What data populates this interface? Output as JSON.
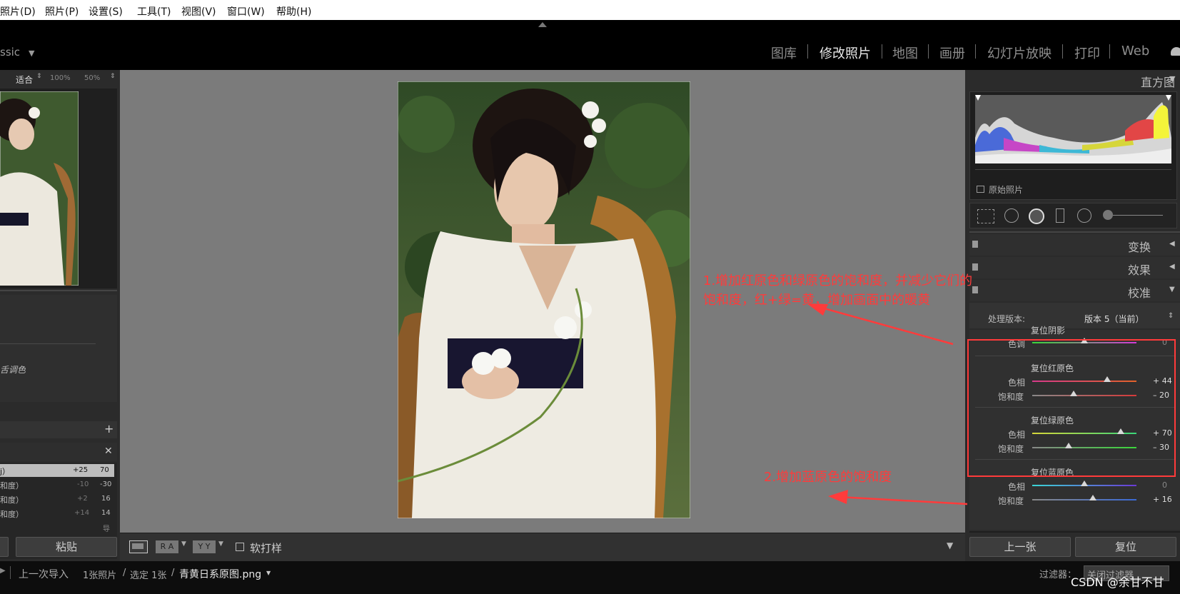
{
  "menu": [
    "照片(D)",
    "照片(P)",
    "设置(S)",
    "工具(T)",
    "视图(V)",
    "窗口(W)",
    "帮助(H)"
  ],
  "identity": "ssic",
  "modules": [
    {
      "label": "图库",
      "active": false
    },
    {
      "label": "修改照片",
      "active": true
    },
    {
      "label": "地图",
      "active": false
    },
    {
      "label": "画册",
      "active": false
    },
    {
      "label": "幻灯片放映",
      "active": false
    },
    {
      "label": "打印",
      "active": false
    },
    {
      "label": "Web",
      "active": false
    }
  ],
  "navigator": {
    "fit": "适合",
    "zoom100": "100%",
    "zoom50": "50%"
  },
  "left": {
    "preset_label": "舌调色",
    "history": [
      {
        "label": "j）",
        "a": "+25",
        "b": "70"
      },
      {
        "label": "和度）",
        "a": "-10",
        "b": "-30"
      },
      {
        "label": "和度）",
        "a": "+2",
        "b": "16"
      },
      {
        "label": "和度）",
        "a": "+14",
        "b": "14"
      }
    ],
    "history_more": "导",
    "paste_button": "粘贴"
  },
  "toolbar": {
    "soft_proof": "软打样",
    "ra": "R A",
    "yy": "Y Y"
  },
  "right": {
    "histogram_title": "直方图",
    "original_photo": "原始照片",
    "panels": [
      "变换",
      "效果",
      "校准"
    ],
    "process_label": "处理版本:",
    "process_value": "版本 5（当前）",
    "sections": [
      {
        "title": "复位阴影",
        "rows": [
          {
            "label": "色调",
            "value": "0",
            "pos": 0.5,
            "track": "shadow"
          }
        ]
      },
      {
        "title": "复位红原色",
        "rows": [
          {
            "label": "色相",
            "value": "+ 44",
            "pos": 0.72,
            "track": "redhue"
          },
          {
            "label": "饱和度",
            "value": "– 20",
            "pos": 0.4,
            "track": "redsat"
          }
        ]
      },
      {
        "title": "复位绿原色",
        "rows": [
          {
            "label": "色相",
            "value": "+ 70",
            "pos": 0.85,
            "track": "greenhue"
          },
          {
            "label": "饱和度",
            "value": "– 30",
            "pos": 0.35,
            "track": "greensat"
          }
        ]
      },
      {
        "title": "复位蓝原色",
        "rows": [
          {
            "label": "色相",
            "value": "0",
            "pos": 0.5,
            "track": "bluehue"
          },
          {
            "label": "饱和度",
            "value": "+ 16",
            "pos": 0.58,
            "track": "bluesat"
          }
        ]
      }
    ],
    "prev_button": "上一张",
    "reset_button": "复位"
  },
  "filmstrip": {
    "source": "上一次导入",
    "count": "1张照片",
    "selected": "选定 1张",
    "filename": "青黄日系原图.png",
    "filter_label": "过滤器：",
    "filter_value": "关闭过滤器"
  },
  "annotations": {
    "note1_line1": "1.增加红原色和绿原色的饱和度，并减少它们的",
    "note1_line2": "饱和度，红+绿=黄，增加画面中的暖黄",
    "note2": "2.增加蓝原色的饱和度"
  },
  "watermark": "CSDN @余甘不甘",
  "colors": {
    "accent_red": "#ff3b3b",
    "panel_bg": "#2b2b2b",
    "stage_bg": "#7b7b7b"
  }
}
